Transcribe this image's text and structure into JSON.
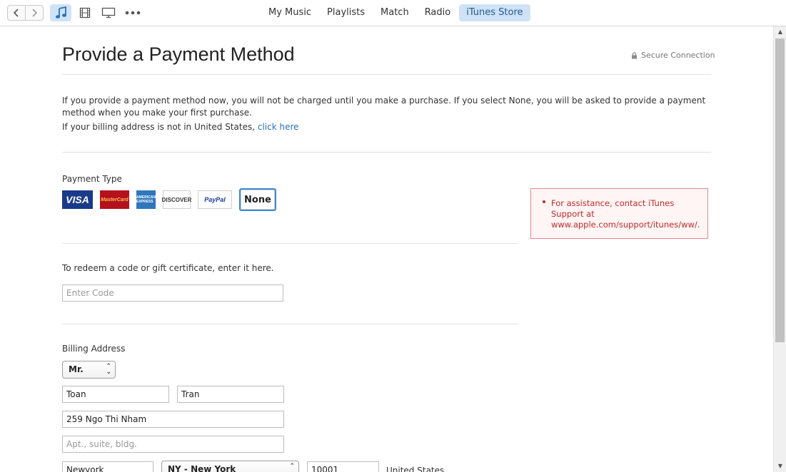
{
  "toolbar": {
    "back_icon": "chevron-left-icon",
    "forward_icon": "chevron-right-icon",
    "media": [
      "music-note-icon",
      "film-icon",
      "tv-icon",
      "more-icon"
    ],
    "tabs": [
      {
        "label": "My Music"
      },
      {
        "label": "Playlists"
      },
      {
        "label": "Match"
      },
      {
        "label": "Radio"
      },
      {
        "label": "iTunes Store"
      }
    ],
    "active_tab": "iTunes Store"
  },
  "page": {
    "title": "Provide a Payment Method",
    "secure_label": "Secure Connection",
    "intro_line1": "If you provide a payment method now, you will not be charged until you make a purchase. If you select None, you will be asked to provide a payment",
    "intro_line2": "method when you make your first purchase.",
    "billing_note": "If your billing address is not in United States, ",
    "billing_link": "click here"
  },
  "payment": {
    "label": "Payment Type",
    "cards": [
      {
        "label": "VISA"
      },
      {
        "label": "MasterCard"
      },
      {
        "label": "AMERICAN EXPRESS"
      },
      {
        "label": "DISCOVER"
      },
      {
        "label": "PayPal"
      },
      {
        "label": "None"
      }
    ],
    "selected": "None"
  },
  "alert": {
    "text": "For assistance, contact iTunes Support at www.apple.com/support/itunes/ww/."
  },
  "redeem": {
    "label": "To redeem a code or gift certificate, enter it here.",
    "placeholder": "Enter Code"
  },
  "billing": {
    "label": "Billing Address",
    "salutation": "Mr.",
    "first_name": "Toan",
    "last_name": "Tran",
    "street": "259 Ngo Thi Nham",
    "apt_placeholder": "Apt., suite, bldg.",
    "city": "Newyork",
    "state": "NY - New York",
    "zip": "10001",
    "country": "United States"
  },
  "colors": {
    "accent": "#2a72b8",
    "active_tab_bg": "#cfe2f6",
    "alert_text": "#c22a2a",
    "alert_border": "#e08b8b"
  }
}
